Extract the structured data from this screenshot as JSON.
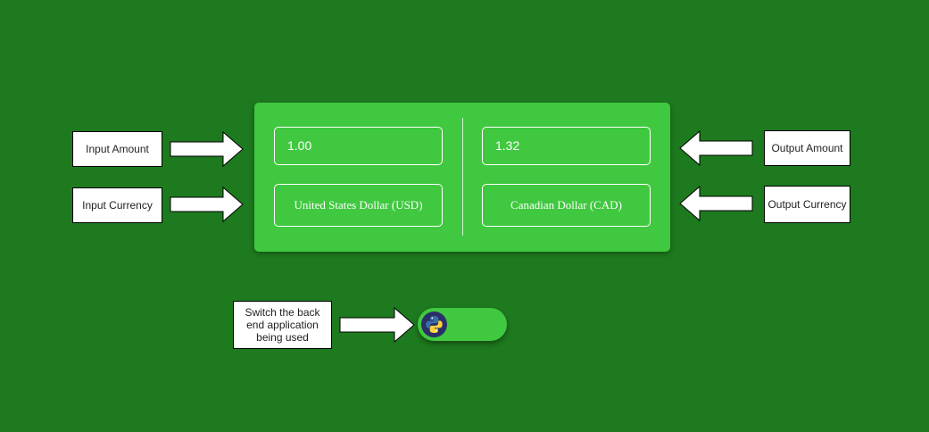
{
  "labels": {
    "input_amount": "Input Amount",
    "input_currency": "Input Currency",
    "output_amount": "Output Amount",
    "output_currency": "Output Currency",
    "switch_backend": "Switch the back end application being used"
  },
  "converter": {
    "input_amount": "1.00",
    "output_amount": "1.32",
    "input_currency": "United States Dollar (USD)",
    "output_currency": "Canadian Dollar (CAD)"
  },
  "toggle": {
    "icon": "python-logo-icon"
  },
  "colors": {
    "background": "#1e7a1e",
    "card": "#40c840",
    "field_border": "#ffffff",
    "python_blue": "#3b6ea5",
    "python_yellow": "#ffd43b"
  }
}
